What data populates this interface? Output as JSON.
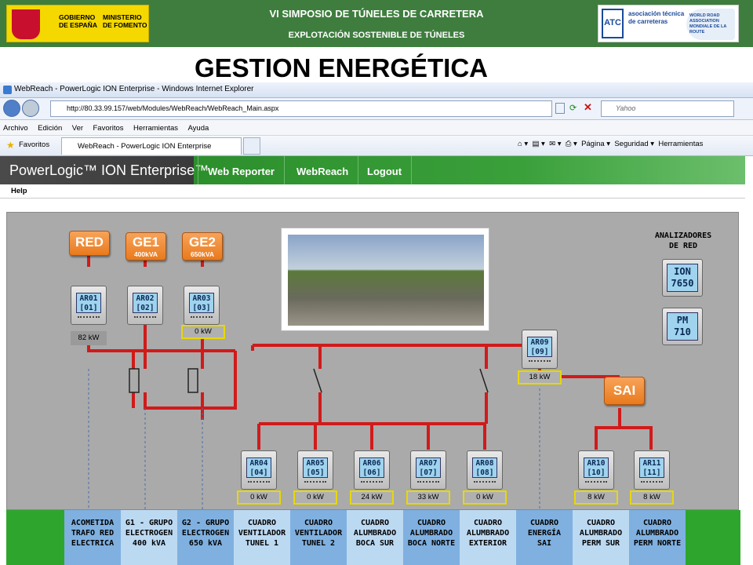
{
  "banner": {
    "gov_logo_line1": "GOBIERNO",
    "gov_logo_line2": "DE ESPAÑA",
    "gov_logo_line3": "MINISTERIO",
    "gov_logo_line4": "DE FOMENTO",
    "title": "VI SIMPOSIO DE TÚNELES DE CARRETERA",
    "subtitle": "EXPLOTACIÓN SOSTENIBLE DE TÚNELES",
    "atc_logo_line1": "asociación técnica",
    "atc_logo_line2": "de carreteras",
    "atc_logo_line3": "WORLD ROAD ASSOCIATION MONDIALE DE LA ROUTE"
  },
  "page_title": "GESTION ENERGÉTICA",
  "browser": {
    "window_title": "WebReach - PowerLogic ION Enterprise - Windows Internet Explorer",
    "url": "http://80.33.99.157/web/Modules/WebReach/WebReach_Main.aspx",
    "search_placeholder": "Yahoo",
    "menu": [
      "Archivo",
      "Edición",
      "Ver",
      "Favoritos",
      "Herramientas",
      "Ayuda"
    ],
    "favorites_label": "Favoritos",
    "tab_label": "WebReach - PowerLogic ION Enterprise",
    "commands": [
      "Página ▾",
      "Seguridad ▾",
      "Herramientas"
    ]
  },
  "app": {
    "brand": "PowerLogic™ ION Enterprise™",
    "nav": [
      "Web Reporter",
      "WebReach",
      "Logout"
    ],
    "help": "Help"
  },
  "sources": [
    {
      "main": "RED",
      "sub": ""
    },
    {
      "main": "GE1",
      "sub": "400kVA"
    },
    {
      "main": "GE2",
      "sub": "650kVA"
    }
  ],
  "ups": "SAI",
  "analyzers": {
    "title_line1": "ANALIZADORES",
    "title_line2": "DE RED",
    "ion_line1": "ION",
    "ion_line2": "7650",
    "pm_line1": "PM",
    "pm_line2": "710"
  },
  "meters": [
    {
      "id": "AR01",
      "num": "[01]",
      "power": "82 kW"
    },
    {
      "id": "AR02",
      "num": "[02]",
      "power": ""
    },
    {
      "id": "AR03",
      "num": "[03]",
      "power": "0 kW"
    },
    {
      "id": "AR04",
      "num": "[04]",
      "power": "0 kW"
    },
    {
      "id": "AR05",
      "num": "[05]",
      "power": "0 kW"
    },
    {
      "id": "AR06",
      "num": "[06]",
      "power": "24 kW"
    },
    {
      "id": "AR07",
      "num": "[07]",
      "power": "33 kW"
    },
    {
      "id": "AR08",
      "num": "[08]",
      "power": "0 kW"
    },
    {
      "id": "AR09",
      "num": "[09]",
      "power": "18 kW"
    },
    {
      "id": "AR10",
      "num": "[10]",
      "power": "8 kW"
    },
    {
      "id": "AR11",
      "num": "[11]",
      "power": "8 kW"
    }
  ],
  "labels": [
    [
      "ACOMETIDA",
      "TRAFO RED",
      "ELECTRICA"
    ],
    [
      "G1 - GRUPO",
      "ELECTROGEN",
      "400 kVA"
    ],
    [
      "G2 - GRUPO",
      "ELECTROGEN",
      "650 kVA"
    ],
    [
      "CUADRO",
      "VENTILADOR",
      "TUNEL 1"
    ],
    [
      "CUADRO",
      "VENTILADOR",
      "TUNEL 2"
    ],
    [
      "CUADRO",
      "ALUMBRADO",
      "BOCA SUR"
    ],
    [
      "CUADRO",
      "ALUMBRADO",
      "BOCA NORTE"
    ],
    [
      "CUADRO",
      "ALUMBRADO",
      "EXTERIOR"
    ],
    [
      "CUADRO",
      "ENERGÍA",
      "SAI"
    ],
    [
      "CUADRO",
      "ALUMBRADO",
      "PERM SUR"
    ],
    [
      "CUADRO",
      "ALUMBRADO",
      "PERM NORTE"
    ]
  ],
  "colors": {
    "banner": "#3e7d3e",
    "app_green": "#2c8f2c",
    "wire": "#d11a1a",
    "source": "#e97a1c",
    "kw_border": "#e8d800"
  }
}
